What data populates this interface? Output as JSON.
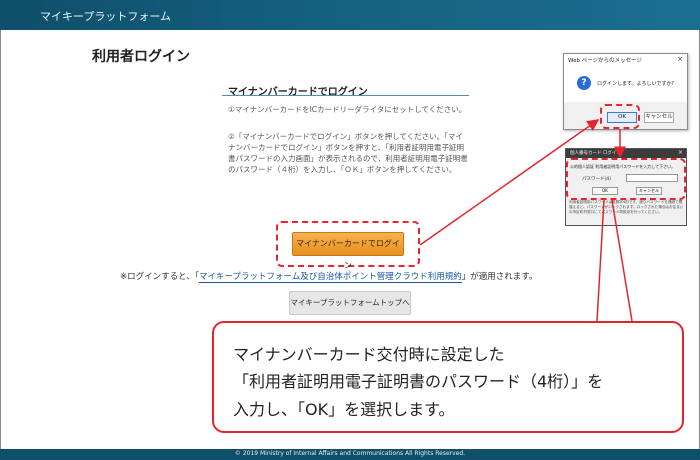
{
  "header": {
    "title": "マイキープラットフォーム"
  },
  "main": {
    "page_title": "利用者ログイン",
    "section_title": "マイナンバーカードでログイン",
    "instructions": [
      "①マイナンバーカードをICカードリーダライタにセットしてください。",
      "②「マイナンバーカードでログイン」ボタンを押してください。「マイナンバーカードでログイン」ボタンを押すと、「利用者証明用電子証明書パスワードの入力画面」が表示されるので、利用者証明用電子証明書のパスワード（４桁）を入力し、「ＯＫ」ボタンを押してください。"
    ],
    "login_button": "マイナンバーカードでログイン",
    "terms_prefix": "※ログインすると、「",
    "terms_link": "マイキープラットフォーム及び自治体ポイント管理クラウド利用規約",
    "terms_suffix": "」が適用されます。",
    "top_button": "マイキープラットフォームトップへ"
  },
  "dialog1": {
    "title": "Web ページからのメッセージ",
    "close": "×",
    "icon": "question-icon",
    "message": "ログインします。よろしいですか?",
    "ok": "OK",
    "cancel": "キャンセル"
  },
  "dialog2": {
    "title": "個人番号カード ログイン",
    "close": "×",
    "message": "公的個人認証 利用者証明用パスワードを入力して下さい。",
    "password_label": "パスワード(4)",
    "ok": "OK",
    "cancel": "キャンセル",
    "note": "利用者証明用パスワードは英数字4桁です。誤りパスワードを連続で間違えると、パスワードがロックされます。ロックされた場合はお住まいの市区町村窓口にてパスワード再設定を行ってください。"
  },
  "callout": {
    "lines": [
      "マイナンバーカード交付時に設定した",
      "「利用者証明用電子証明書のパスワード（4桁）」を",
      "入力し、「OK」を選択します。"
    ]
  },
  "footer": {
    "copyright": "© 2019 Ministry of Internal Affairs and Communications All Rights Reserved."
  },
  "colors": {
    "header": "#14607f",
    "accent_red": "#e5232d",
    "login_button": "#f0a43a",
    "link": "#1a56a8"
  }
}
